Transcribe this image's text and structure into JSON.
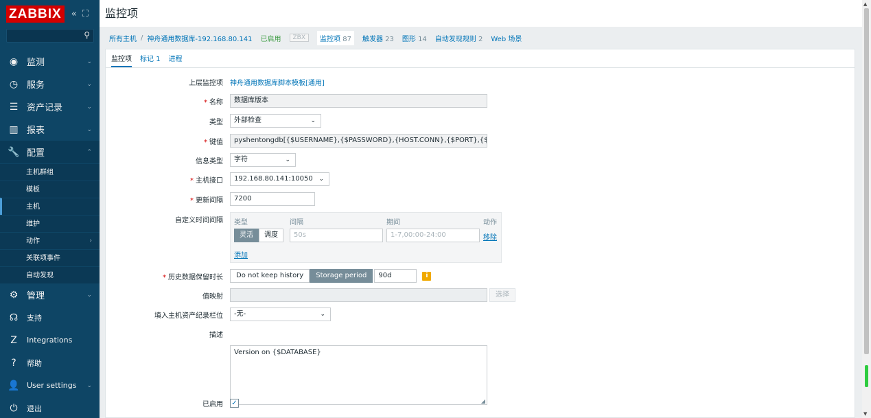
{
  "sidebar": {
    "logo": "ZABBIX",
    "collapse_glyph": "«",
    "kiosk_glyph": "⛶",
    "search_placeholder": "",
    "menu": [
      {
        "label": "监测",
        "icon": "eye-icon",
        "glyph": "◉"
      },
      {
        "label": "服务",
        "icon": "clock-icon",
        "glyph": "◷"
      },
      {
        "label": "资产记录",
        "icon": "list-icon",
        "glyph": "☰"
      },
      {
        "label": "报表",
        "icon": "bar-chart-icon",
        "glyph": "▥"
      },
      {
        "label": "配置",
        "icon": "wrench-icon",
        "glyph": "🔧"
      },
      {
        "label": "管理",
        "icon": "gear-icon",
        "glyph": "⚙"
      },
      {
        "label": "支持",
        "icon": "headset-icon",
        "glyph": "☊"
      },
      {
        "label": "Integrations",
        "icon": "zabbix-z-icon",
        "glyph": "Z"
      },
      {
        "label": "帮助",
        "icon": "help-icon",
        "glyph": "?"
      },
      {
        "label": "User settings",
        "icon": "user-icon",
        "glyph": "👤"
      },
      {
        "label": "退出",
        "icon": "power-icon",
        "glyph": "⏻"
      }
    ],
    "config_submenu": [
      "主机群组",
      "模板",
      "主机",
      "维护",
      "动作",
      "关联项事件",
      "自动发现"
    ]
  },
  "page": {
    "title": "监控项"
  },
  "breadcrumbs": {
    "all_hosts": "所有主机",
    "sep": "/",
    "host": "神舟通用数据库-192.168.80.141",
    "status": "已启用",
    "zbx": "ZBX",
    "items": "监控项",
    "items_count": "87",
    "triggers": "触发器",
    "triggers_count": "23",
    "graphs": "图形",
    "graphs_count": "14",
    "discovery": "自动发现规则",
    "discovery_count": "2",
    "web": "Web 场景"
  },
  "tabs": [
    {
      "label": "监控项"
    },
    {
      "label": "标记",
      "count": "1"
    },
    {
      "label": "进程"
    }
  ],
  "form": {
    "parent_label": "上层监控项",
    "parent_value": "神舟通用数据库脚本模板[通用]",
    "name_label": "名称",
    "name_value": "数据库版本",
    "type_label": "类型",
    "type_value": "外部检查",
    "key_label": "键值",
    "key_value": "pyshentongdb[{$USERNAME},{$PASSWORD},{HOST.CONN},{$PORT},{$DATABA",
    "info_type_label": "信息类型",
    "info_type_value": "字符",
    "interface_label": "主机接口",
    "interface_value": "192.168.80.141:10050",
    "interval_label": "更新间隔",
    "interval_value": "7200",
    "custom_intervals_label": "自定义时间间隔",
    "cti": {
      "col_type": "类型",
      "col_interval": "间隔",
      "col_period": "期间",
      "col_action": "动作",
      "flexible": "灵活",
      "scheduling": "调度",
      "interval_placeholder": "50s",
      "period_placeholder": "1-7,00:00-24:00",
      "remove": "移除",
      "add": "添加"
    },
    "history_label": "历史数据保留时长",
    "history_no_keep": "Do not keep history",
    "history_storage": "Storage period",
    "history_value": "90d",
    "valuemap_label": "值映射",
    "valuemap_value": "",
    "valuemap_select": "选择",
    "inventory_label": "填入主机资产纪录栏位",
    "inventory_value": "-无-",
    "desc_label": "描述",
    "desc_value": "Version on {$DATABASE}",
    "enabled_label": "已启用",
    "enabled_checked": true
  }
}
